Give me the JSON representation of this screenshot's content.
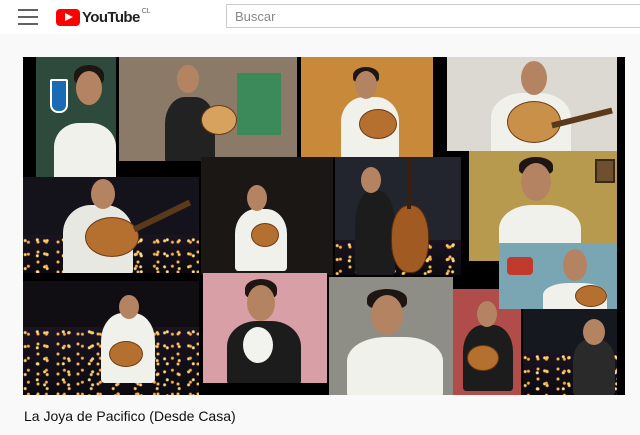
{
  "masthead": {
    "logo_text": "YouTube",
    "region_code": "CL",
    "search": {
      "placeholder": "Buscar",
      "value": ""
    },
    "icons": [
      "menu-icon",
      "youtube-logo-icon"
    ]
  },
  "video": {
    "title": "La Joya de Pacifico (Desde Casa)"
  },
  "colors": {
    "brand_red": "#ff0000",
    "page_bg": "#f9f9f9",
    "player_bg": "#000000"
  }
}
